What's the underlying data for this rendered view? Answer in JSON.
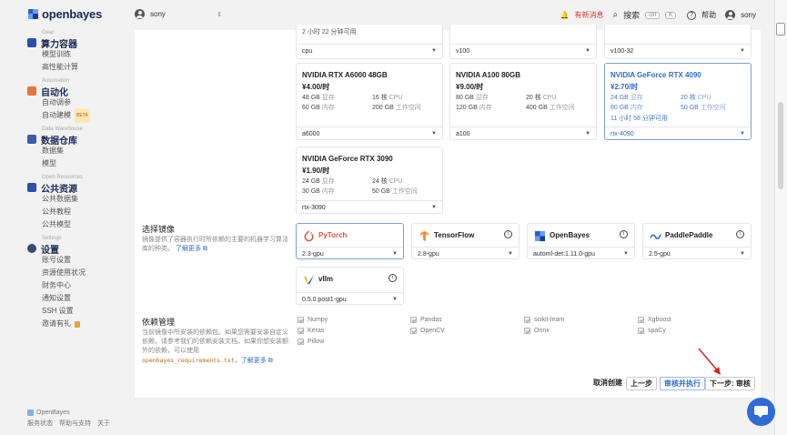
{
  "brand": {
    "name": "openbayes"
  },
  "topbar": {
    "user": "sony",
    "notifications": "有新消息",
    "search_kbd_ctrl": "ctrl",
    "search_kbd_k": "K",
    "help": "帮助",
    "account": "sony"
  },
  "sidebar": {
    "sections": [
      {
        "label": "Gear",
        "title": "算力容器",
        "items": [
          "模型训练",
          "高性能计算"
        ]
      },
      {
        "label": "Automation",
        "title": "自动化",
        "items": [
          "自动调参",
          "自动建模"
        ],
        "badge": "BETA"
      },
      {
        "label": "Data Warehouse",
        "title": "数据仓库",
        "items": [
          "数据集",
          "模型"
        ]
      },
      {
        "label": "Open Resources",
        "title": "公共资源",
        "items": [
          "公共数据集",
          "公共教程",
          "公共模型"
        ]
      },
      {
        "label": "Settings",
        "title": "设置",
        "items": [
          "账号设置",
          "资源使用状况",
          "财务中心",
          "通知设置",
          "SSH 设置",
          "邀请有礼"
        ]
      }
    ],
    "footer": {
      "brand": "OpenBayes",
      "links": [
        "服务状态",
        "帮助与支持",
        "关于"
      ]
    }
  },
  "compute": {
    "top_partial": {
      "avail": "2 小时 22 分钟可用",
      "selects": [
        "cpu",
        "v100",
        "v100-32"
      ]
    },
    "cards": [
      {
        "name": "NVIDIA RTX A6000 48GB",
        "price": "¥4.00/时",
        "vram": "48 GB",
        "vram_l": "显存",
        "cpu": "16 核",
        "cpu_l": "CPU",
        "mem": "60 GB",
        "mem_l": "内存",
        "disk": "200 GB",
        "disk_l": "工作空间",
        "select": "a6000"
      },
      {
        "name": "NVIDIA A100 80GB",
        "price": "¥9.00/时",
        "vram": "80 GB",
        "vram_l": "显存",
        "cpu": "20 核",
        "cpu_l": "CPU",
        "mem": "120 GB",
        "mem_l": "内存",
        "disk": "400 GB",
        "disk_l": "工作空间",
        "select": "a100"
      },
      {
        "name": "NVIDIA GeForce RTX 4090",
        "price": "¥2.70/时",
        "vram": "24 GB",
        "vram_l": "显存",
        "cpu": "20 核",
        "cpu_l": "CPU",
        "mem": "80 GB",
        "mem_l": "内存",
        "disk": "50 GB",
        "disk_l": "工作空间",
        "avail": "11 小时 58 分钟可用",
        "select": "rtx-4090"
      },
      {
        "name": "NVIDIA GeForce RTX 3090",
        "price": "¥1.90/时",
        "vram": "24 GB",
        "vram_l": "显存",
        "cpu": "24 核",
        "cpu_l": "CPU",
        "mem": "30 GB",
        "mem_l": "内存",
        "disk": "50 GB",
        "disk_l": "工作空间",
        "select": "rtx-3090"
      }
    ]
  },
  "image_section": {
    "label": "选择镜像",
    "desc": "镜像提供了容器执行时所依赖的主要的机器学习算法库的种类。",
    "link": "了解更多",
    "frameworks": [
      {
        "name": "PyTorch",
        "version": "2.3-gpu"
      },
      {
        "name": "TensorFlow",
        "version": "2.8-gpu"
      },
      {
        "name": "OpenBayes",
        "version": "automl-det:1.11.0-gpu"
      },
      {
        "name": "PaddlePaddle",
        "version": "2.5-gpu"
      },
      {
        "name": "vllm",
        "version": "0.5.0.post1-gpu"
      }
    ]
  },
  "deps_section": {
    "label": "依赖管理",
    "desc": "当前镜像中所安装的依赖包。如果您需要安装自定义依赖，请参考我们的依赖安装文档。如果你想安装额外的依赖，可以使用",
    "file": "openbayes_requirements.txt",
    "suffix": "，",
    "link": "了解更多",
    "packages": [
      "Numpy",
      "Pandas",
      "scikit-learn",
      "Xgboost",
      "Keras",
      "OpenCV",
      "Onnx",
      "spaCy",
      "Pillow"
    ]
  },
  "actions": {
    "cancel": "取消创建",
    "prev": "上一步",
    "review_run": "审核并执行",
    "next": "下一步: 审核"
  },
  "colors": {
    "accent": "#2e6bd6",
    "pytorch": "#e0533b",
    "annotation_arrow": "#e02020"
  }
}
